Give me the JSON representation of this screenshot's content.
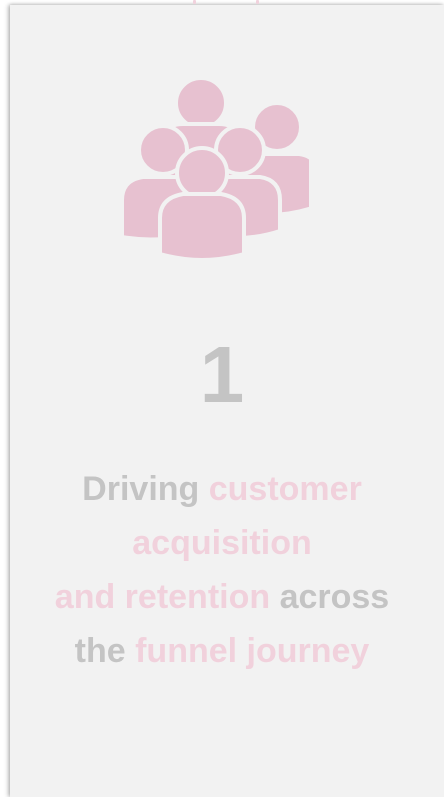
{
  "step": {
    "number": "1",
    "icon": "group-users-icon",
    "description_lines": [
      [
        {
          "text": "Driving ",
          "tone": "gray"
        },
        {
          "text": "customer",
          "tone": "pink"
        }
      ],
      [
        {
          "text": "acquisition",
          "tone": "pink"
        }
      ],
      [
        {
          "text": "and retention",
          "tone": "pink"
        },
        {
          "text": " across",
          "tone": "gray"
        }
      ],
      [
        {
          "text": "the ",
          "tone": "gray"
        },
        {
          "text": "funnel journey",
          "tone": "pink"
        }
      ]
    ]
  },
  "colors": {
    "card_background": "#f2f2f2",
    "text_gray": "#c4c4c4",
    "accent_pink": "#f1d1dc",
    "icon_pink": "#e7c1d0"
  }
}
